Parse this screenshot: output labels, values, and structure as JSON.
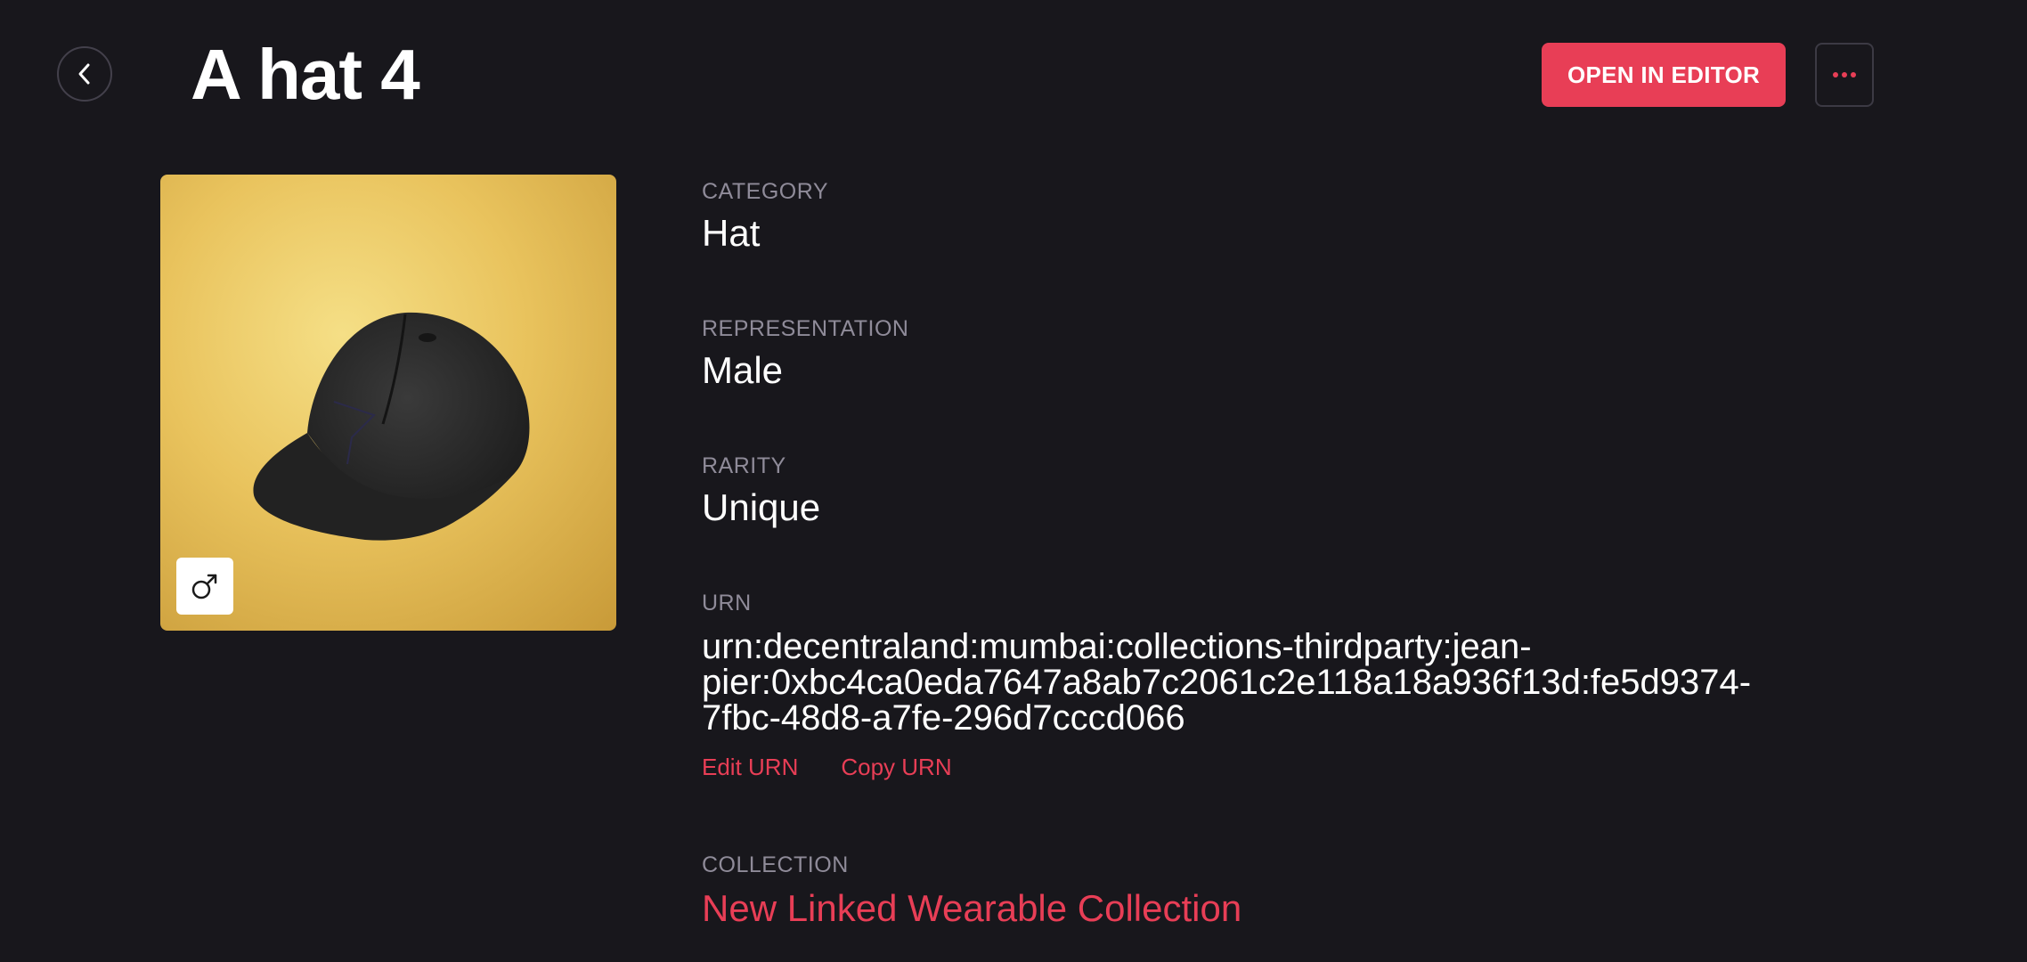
{
  "header": {
    "title": "A hat 4",
    "open_editor_label": "OPEN IN EDITOR",
    "back_icon": "chevron-left-icon",
    "more_icon": "ellipsis-icon",
    "accent_color": "#e83e56"
  },
  "preview": {
    "alt": "black baseball cap",
    "gender_icon": "male-symbol-icon",
    "background_color": "#e9c35d"
  },
  "details": {
    "category": {
      "label": "CATEGORY",
      "value": "Hat"
    },
    "representation": {
      "label": "REPRESENTATION",
      "value": "Male"
    },
    "rarity": {
      "label": "RARITY",
      "value": "Unique"
    },
    "urn": {
      "label": "URN",
      "line1": "urn:decentraland:mumbai:collections-thirdparty:jean-",
      "line2": "pier:0xbc4ca0eda7647a8ab7c2061c2e118a18a936f13d:fe5d9374-",
      "line3": "7fbc-48d8-a7fe-296d7cccd066",
      "edit_label": "Edit URN",
      "copy_label": "Copy URN"
    },
    "collection": {
      "label": "COLLECTION",
      "value": "New Linked Wearable Collection"
    }
  }
}
